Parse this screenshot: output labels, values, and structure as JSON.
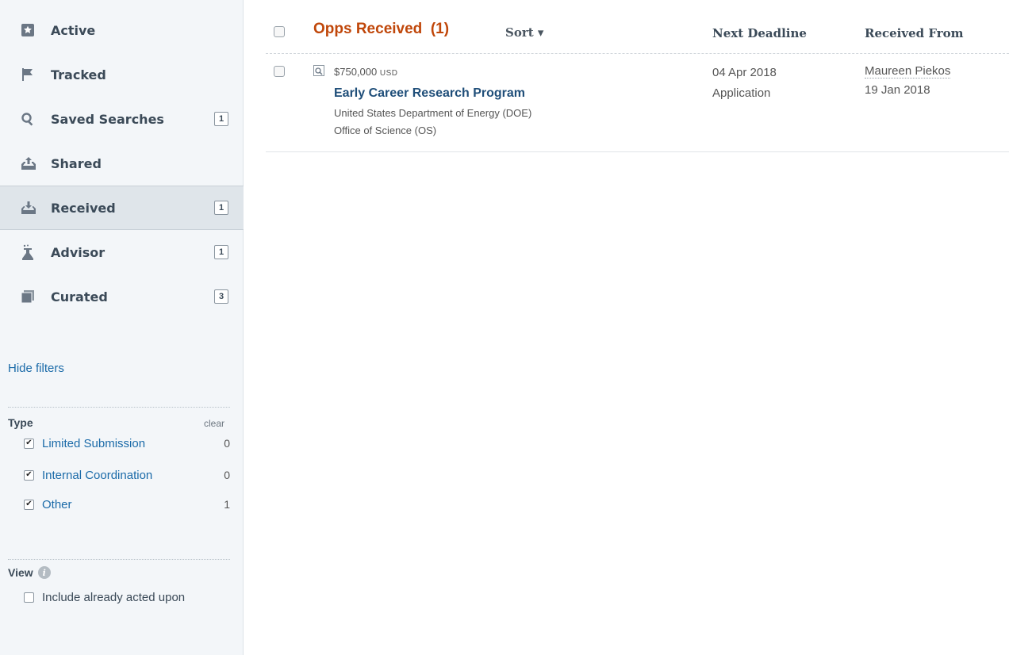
{
  "sidebar": {
    "nav": [
      {
        "label": "Active",
        "icon": "star-icon",
        "badge": ""
      },
      {
        "label": "Tracked",
        "icon": "flag-icon",
        "badge": ""
      },
      {
        "label": "Saved Searches",
        "icon": "search-icon",
        "badge": "1"
      },
      {
        "label": "Shared",
        "icon": "upload-tray-icon",
        "badge": ""
      },
      {
        "label": "Received",
        "icon": "download-tray-icon",
        "badge": "1"
      },
      {
        "label": "Advisor",
        "icon": "flask-icon",
        "badge": "1"
      },
      {
        "label": "Curated",
        "icon": "stack-icon",
        "badge": "3"
      }
    ],
    "hide_filters": "Hide filters",
    "type_filter": {
      "title": "Type",
      "clear": "clear",
      "items": [
        {
          "label": "Limited Submission",
          "count": "0",
          "checked": true
        },
        {
          "label": "Internal Coordination",
          "count": "0",
          "checked": true
        },
        {
          "label": "Other",
          "count": "1",
          "checked": true
        }
      ]
    },
    "view_filter": {
      "title": "View",
      "option": {
        "label": "Include already acted upon",
        "checked": false
      }
    }
  },
  "main": {
    "header": {
      "title": "Opps Received  (1)",
      "sort": "Sort ▾",
      "col_deadline": "Next Deadline",
      "col_received_from": "Received From"
    },
    "rows": [
      {
        "amount": "$750,000",
        "currency": "USD",
        "title": "Early Career Research Program",
        "agency": "United States Department of Energy (DOE)",
        "office": "Office of Science (OS)",
        "deadline": "04 Apr 2018",
        "deadline_type": "Application",
        "received_from": "Maureen Piekos",
        "received_date": "19 Jan 2018"
      }
    ]
  },
  "colors": {
    "accent_title": "#c0470a",
    "link": "#1a6aa8",
    "sidebar_bg": "#f3f6f9",
    "active_item_bg": "#dfe5ea"
  }
}
